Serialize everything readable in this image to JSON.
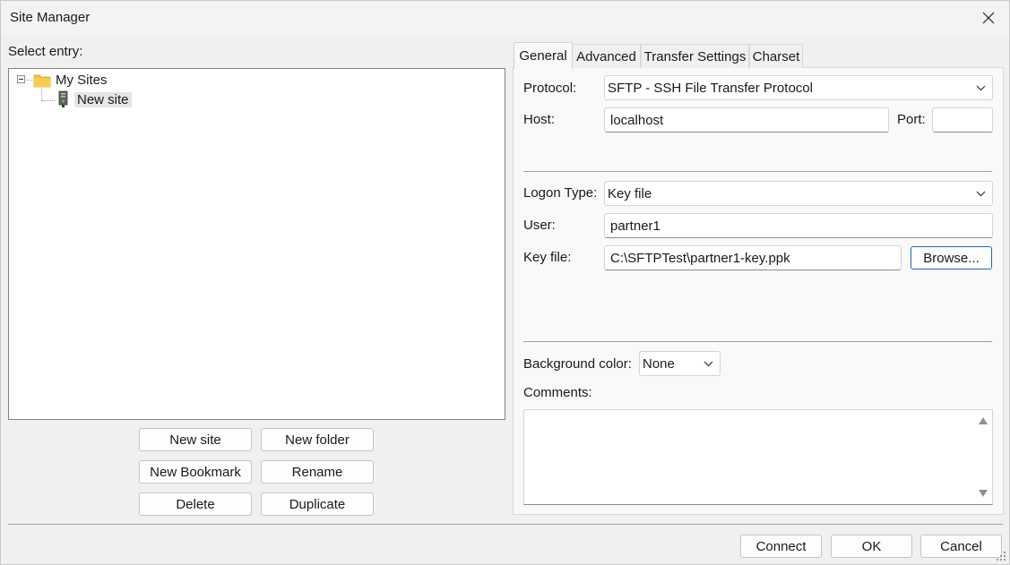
{
  "window": {
    "title": "Site Manager"
  },
  "left": {
    "select_entry_label": "Select entry:",
    "tree": {
      "root": {
        "label": "My Sites",
        "icon": "folder-icon"
      },
      "children": [
        {
          "label": "New site",
          "icon": "server-icon",
          "selected": true
        }
      ]
    },
    "buttons": {
      "new_site": "New site",
      "new_folder": "New folder",
      "new_bookmark": "New Bookmark",
      "rename": "Rename",
      "delete": "Delete",
      "duplicate": "Duplicate"
    }
  },
  "tabs": [
    "General",
    "Advanced",
    "Transfer Settings",
    "Charset"
  ],
  "active_tab": "General",
  "general": {
    "protocol_label": "Protocol:",
    "protocol_value": "SFTP - SSH File Transfer Protocol",
    "host_label": "Host:",
    "host_value": "localhost",
    "port_label": "Port:",
    "port_value": "",
    "logon_type_label": "Logon Type:",
    "logon_type_value": "Key file",
    "user_label": "User:",
    "user_value": "partner1",
    "key_file_label": "Key file:",
    "key_file_value": "C:\\SFTPTest\\partner1-key.ppk",
    "browse_label": "Browse...",
    "background_color_label": "Background color:",
    "background_color_value": "None",
    "comments_label": "Comments:",
    "comments_value": ""
  },
  "footer": {
    "connect": "Connect",
    "ok": "OK",
    "cancel": "Cancel"
  },
  "colors": {
    "accent": "#1f66b8",
    "folder": "#f2c044",
    "window_bg": "#f0f0f0"
  }
}
